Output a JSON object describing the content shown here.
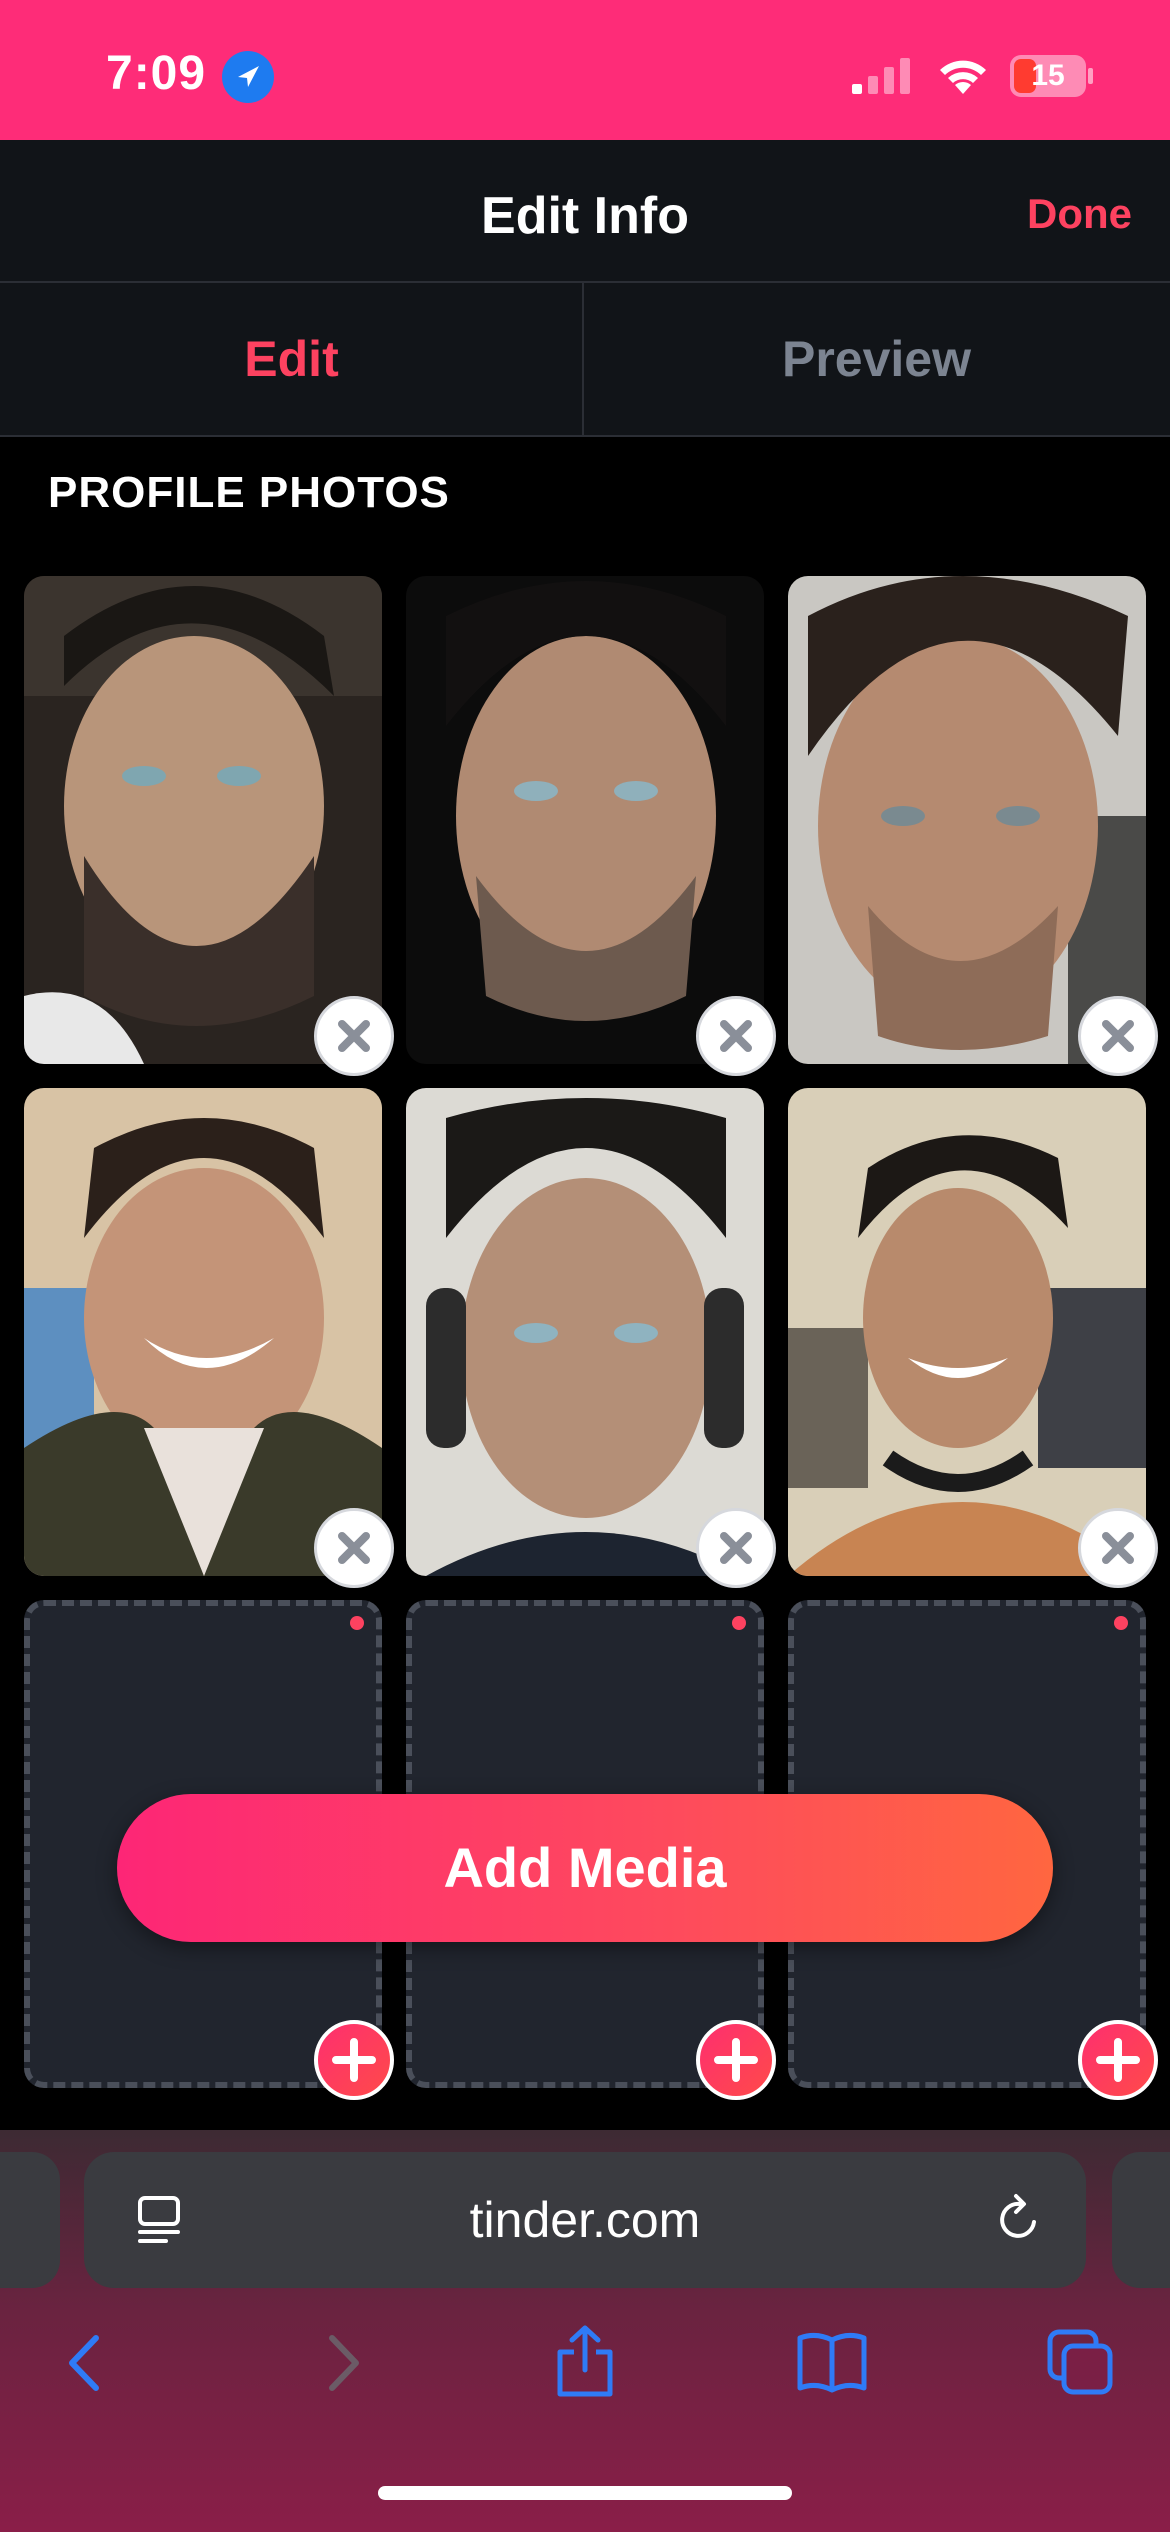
{
  "status_bar": {
    "time": "7:09",
    "battery": "15",
    "location_icon": "location-arrow-icon",
    "signal_icon": "cellular-signal-icon",
    "wifi_icon": "wifi-icon"
  },
  "header": {
    "title": "Edit Info",
    "done_label": "Done"
  },
  "tabs": [
    {
      "label": "Edit",
      "active": true
    },
    {
      "label": "Preview",
      "active": false
    }
  ],
  "section": {
    "title": "PROFILE PHOTOS"
  },
  "photos": [
    {
      "index": 1,
      "filled": true,
      "action_icon": "remove-icon"
    },
    {
      "index": 2,
      "filled": true,
      "action_icon": "remove-icon"
    },
    {
      "index": 3,
      "filled": true,
      "action_icon": "remove-icon"
    },
    {
      "index": 4,
      "filled": true,
      "action_icon": "remove-icon"
    },
    {
      "index": 5,
      "filled": true,
      "action_icon": "remove-icon"
    },
    {
      "index": 6,
      "filled": true,
      "action_icon": "remove-icon"
    },
    {
      "index": 7,
      "filled": false,
      "action_icon": "add-icon"
    },
    {
      "index": 8,
      "filled": false,
      "action_icon": "add-icon"
    },
    {
      "index": 9,
      "filled": false,
      "action_icon": "add-icon"
    }
  ],
  "add_media": {
    "label": "Add Media"
  },
  "browser": {
    "url": "tinder.com"
  },
  "colors": {
    "brand": "#fe2c78",
    "accent": "#fd4260",
    "header_bg": "#111418",
    "tab_inactive": "#7c8491"
  }
}
